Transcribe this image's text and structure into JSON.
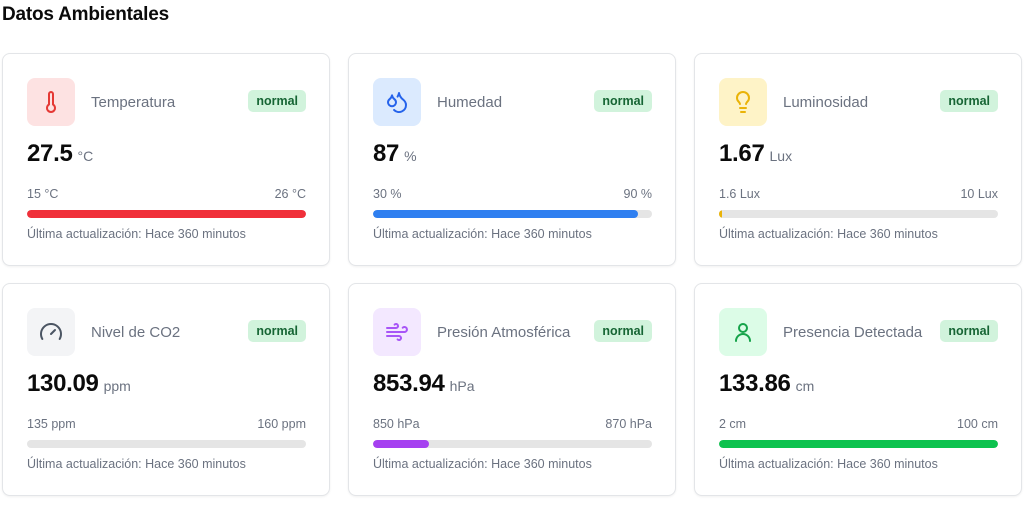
{
  "page": {
    "title": "Datos Ambientales"
  },
  "cards": [
    {
      "id": "temperatura",
      "label": "Temperatura",
      "status": "normal",
      "value": "27.5",
      "unit": "°C",
      "min": "15 °C",
      "max": "26 °C",
      "fill_percent": 100,
      "color": "#f0303a",
      "icon": "thermometer-icon",
      "icon_bg": "#fde2e2",
      "icon_color": "#e53935",
      "updated": "Última actualización: Hace 360 minutos"
    },
    {
      "id": "humedad",
      "label": "Humedad",
      "status": "normal",
      "value": "87",
      "unit": "%",
      "min": "30 %",
      "max": "90 %",
      "fill_percent": 95,
      "color": "#2f7ff0",
      "icon": "droplets-icon",
      "icon_bg": "#dbeafe",
      "icon_color": "#2563eb",
      "updated": "Última actualización: Hace 360 minutos"
    },
    {
      "id": "luminosidad",
      "label": "Luminosidad",
      "status": "normal",
      "value": "1.67",
      "unit": "Lux",
      "min": "1.6 Lux",
      "max": "10 Lux",
      "fill_percent": 1,
      "color": "#eab308",
      "icon": "lightbulb-icon",
      "icon_bg": "#fef3c7",
      "icon_color": "#eab308",
      "updated": "Última actualización: Hace 360 minutos"
    },
    {
      "id": "co2",
      "label": "Nivel de CO2",
      "status": "normal",
      "value": "130.09",
      "unit": "ppm",
      "min": "135 ppm",
      "max": "160 ppm",
      "fill_percent": 0,
      "color": "#9ca3af",
      "icon": "gauge-icon",
      "icon_bg": "#f3f4f6",
      "icon_color": "#4b5563",
      "updated": "Última actualización: Hace 360 minutos"
    },
    {
      "id": "presion",
      "label": "Presión Atmosférica",
      "status": "normal",
      "value": "853.94",
      "unit": "hPa",
      "min": "850 hPa",
      "max": "870 hPa",
      "fill_percent": 20,
      "color": "#a540f0",
      "icon": "wind-icon",
      "icon_bg": "#f3e8ff",
      "icon_color": "#a855f7",
      "updated": "Última actualización: Hace 360 minutos"
    },
    {
      "id": "presencia",
      "label": "Presencia Detectada",
      "status": "normal",
      "value": "133.86",
      "unit": "cm",
      "min": "2 cm",
      "max": "100 cm",
      "fill_percent": 100,
      "color": "#0dc24e",
      "icon": "person-icon",
      "icon_bg": "#dcfce7",
      "icon_color": "#16a34a",
      "updated": "Última actualización: Hace 360 minutos"
    }
  ]
}
